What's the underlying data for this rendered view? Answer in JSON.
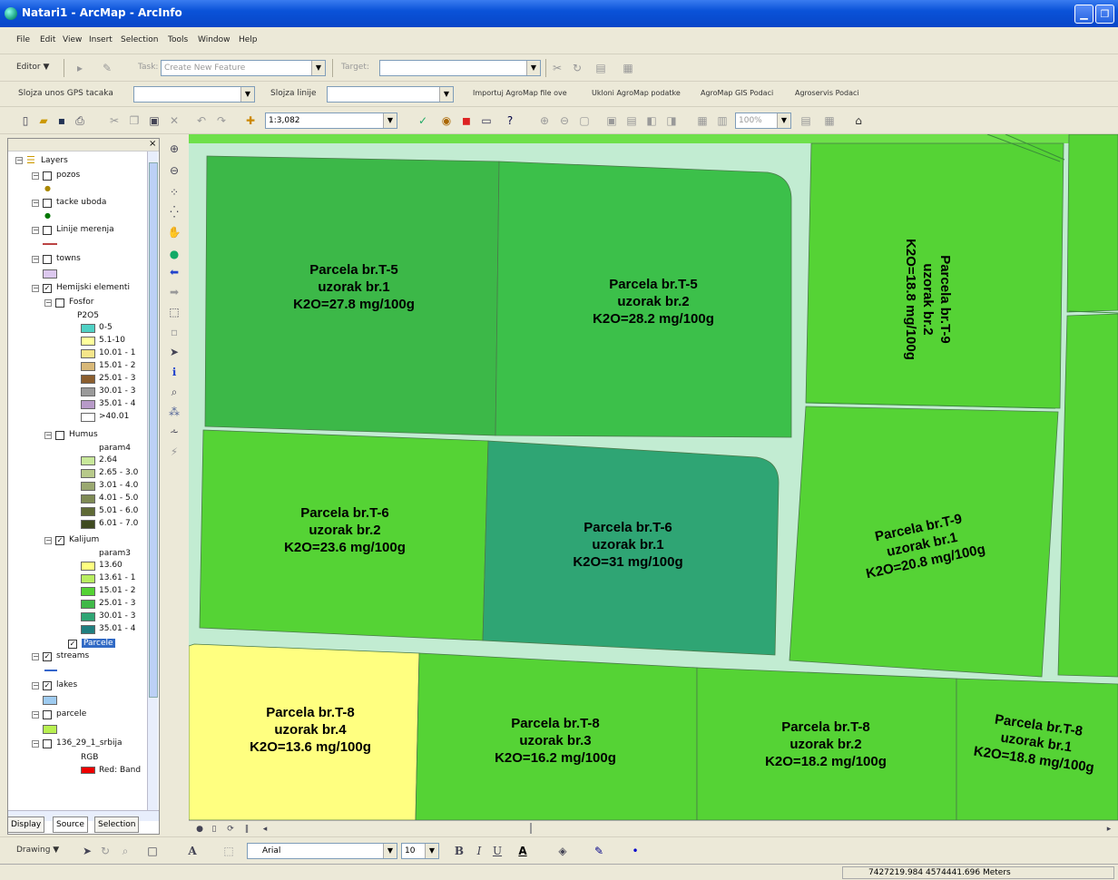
{
  "window": {
    "title": "Natari1 - ArcMap - ArcInfo"
  },
  "menu": [
    "File",
    "Edit",
    "View",
    "Insert",
    "Selection",
    "Tools",
    "Window",
    "Help"
  ],
  "editor": {
    "editor_label": "Editor ▼",
    "task_label": "Task:",
    "task_value": "Create New Feature",
    "target_label": "Target:"
  },
  "agro": {
    "point_label": "Slojza unos GPS tacaka",
    "line_label": "Slojza linije",
    "links": [
      "Importuj AgroMap file ove",
      "Ukloni AgroMap podatke",
      "AgroMap GIS Podaci",
      "Agroservis Podaci"
    ]
  },
  "standard": {
    "scale": "1:3,082",
    "zoom_pct": "100%"
  },
  "toc": {
    "root": "Layers",
    "layers": [
      {
        "name": "pozos",
        "checked": false
      },
      {
        "name": "tacke uboda",
        "checked": false
      },
      {
        "name": "Linije merenja",
        "checked": false
      },
      {
        "name": "towns",
        "checked": false
      },
      {
        "name": "Hemijski elementi",
        "checked": true
      },
      {
        "name": "Fosfor",
        "checked": false,
        "field": "P2O5"
      },
      {
        "name": "Humus",
        "checked": false,
        "field": "param4"
      },
      {
        "name": "Kalijum",
        "checked": true,
        "field": "param3"
      },
      {
        "name": "Parcele",
        "checked": true
      },
      {
        "name": "streams",
        "checked": true
      },
      {
        "name": "lakes",
        "checked": true
      },
      {
        "name": "parcele",
        "checked": false
      },
      {
        "name": "136_29_1_srbija",
        "checked": false,
        "band_label": "RGB",
        "band_value": "Red: Band"
      }
    ],
    "fosfor_classes": [
      {
        "label": "0-5",
        "color": "#4fd1c5"
      },
      {
        "label": "5.1-10",
        "color": "#ffff9c"
      },
      {
        "label": "10.01 - 1",
        "color": "#f5e58a"
      },
      {
        "label": "15.01 - 2",
        "color": "#d8b878"
      },
      {
        "label": "25.01 - 3",
        "color": "#8b5e2e"
      },
      {
        "label": "30.01 - 3",
        "color": "#9a9a9a"
      },
      {
        "label": "35.01 - 4",
        "color": "#b79ac8"
      },
      {
        "label": ">40.01",
        "color": "#ffffff"
      }
    ],
    "humus_classes": [
      {
        "label": "2.64",
        "color": "#c8e89a"
      },
      {
        "label": "2.65 - 3.0",
        "color": "#b7c98a"
      },
      {
        "label": "3.01 - 4.0",
        "color": "#9aa870"
      },
      {
        "label": "4.01 - 5.0",
        "color": "#7e8a55"
      },
      {
        "label": "5.01 - 6.0",
        "color": "#5f6a36"
      },
      {
        "label": "6.01 - 7.0",
        "color": "#3f4a20"
      }
    ],
    "kalijum_classes": [
      {
        "label": "13.60",
        "color": "#ffff80"
      },
      {
        "label": "13.61 - 1",
        "color": "#b8ee60"
      },
      {
        "label": "15.01 - 2",
        "color": "#55d335"
      },
      {
        "label": "25.01 - 3",
        "color": "#3fb848"
      },
      {
        "label": "30.01 - 3",
        "color": "#2fa574"
      },
      {
        "label": "35.01 - 4",
        "color": "#1f7f80"
      }
    ],
    "tabs": [
      "Display",
      "Source",
      "Selection"
    ]
  },
  "parcels": [
    {
      "id": "T5-1",
      "lines": [
        "Parcela br.T-5",
        "uzorak br.1",
        "K2O=27.8  mg/100g"
      ],
      "color": "#3cb848"
    },
    {
      "id": "T5-2",
      "lines": [
        "Parcela br.T-5",
        "uzorak br.2",
        "K2O=28.2  mg/100g"
      ],
      "color": "#3cc04a"
    },
    {
      "id": "T9-2",
      "lines": [
        "Parcela br.T-9",
        "uzorak br.2",
        "K2O=18.8  mg/100g"
      ],
      "color": "#55d335"
    },
    {
      "id": "T6-2",
      "lines": [
        "Parcela br.T-6",
        "uzorak br.2",
        "K2O=23.6  mg/100g"
      ],
      "color": "#55d335"
    },
    {
      "id": "T6-1",
      "lines": [
        "Parcela br.T-6",
        "uzorak br.1",
        "K2O=31  mg/100g"
      ],
      "color": "#2fa574"
    },
    {
      "id": "T9-1",
      "lines": [
        "Parcela br.T-9",
        "uzorak br.1",
        "K2O=20.8  mg/100g"
      ],
      "color": "#55d335"
    },
    {
      "id": "T8-4",
      "lines": [
        "Parcela br.T-8",
        "uzorak br.4",
        "K2O=13.6  mg/100g"
      ],
      "color": "#ffff80"
    },
    {
      "id": "T8-3",
      "lines": [
        "Parcela br.T-8",
        "uzorak br.3",
        "K2O=16.2  mg/100g"
      ],
      "color": "#55d335"
    },
    {
      "id": "T8-2",
      "lines": [
        "Parcela br.T-8",
        "uzorak br.2",
        "K2O=18.2  mg/100g"
      ],
      "color": "#55d335"
    },
    {
      "id": "T8-1",
      "lines": [
        "Parcela br.T-8",
        "uzorak br.1",
        "K2O=18.8  mg/100g"
      ],
      "color": "#55d335"
    }
  ],
  "drawing": {
    "label": "Drawing ▼",
    "font": "Arial",
    "size": "10"
  },
  "status": {
    "coords": "7427219.984  4574441.696 Meters"
  }
}
